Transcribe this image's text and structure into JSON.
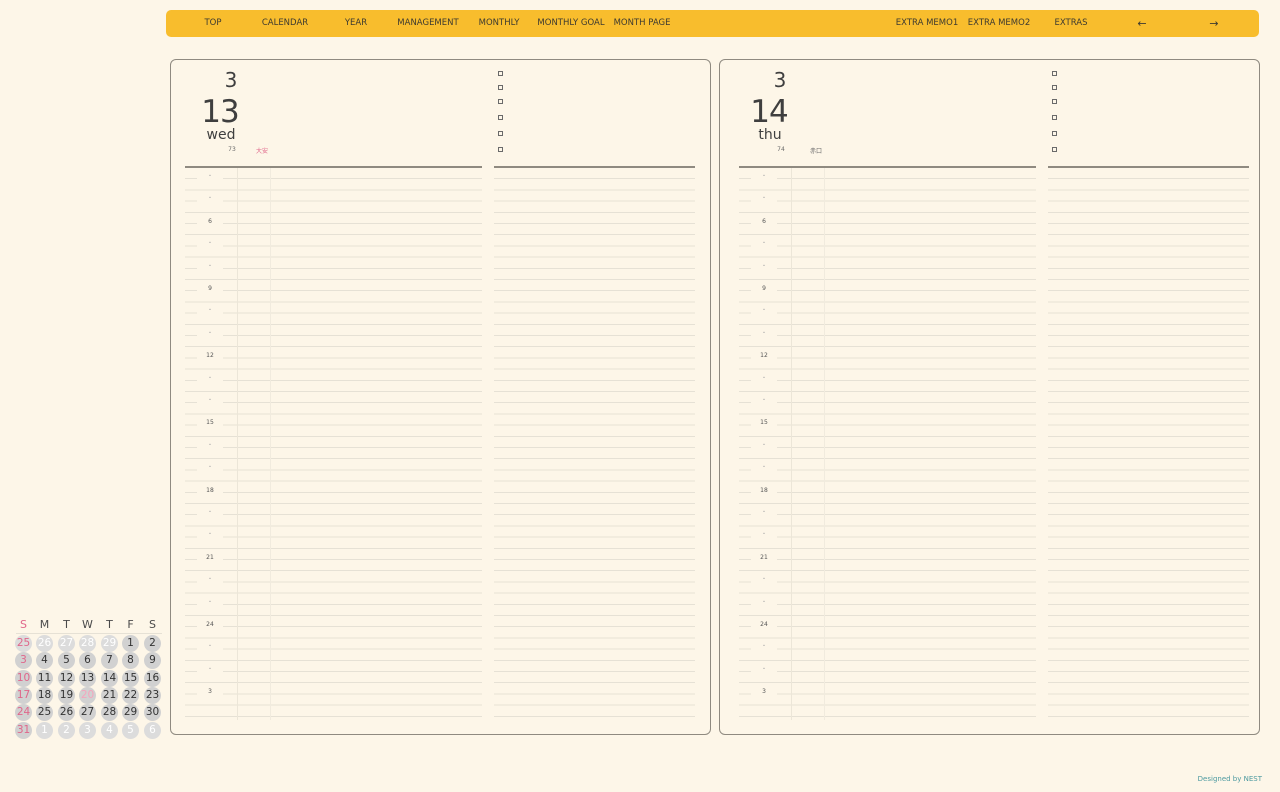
{
  "nav": {
    "items": [
      "TOP",
      "CALENDAR",
      "YEAR",
      "MANAGEMENT",
      "MONTHLY",
      "MONTHLY GOAL",
      "MONTH PAGE",
      "EXTRA MEMO1",
      "EXTRA MEMO2",
      "EXTRAS"
    ],
    "prev_arrow": "←",
    "next_arrow": "→"
  },
  "pages": [
    {
      "month": "3",
      "day": "13",
      "weekday": "wed",
      "day_of_year": "73",
      "note": "大安"
    },
    {
      "month": "3",
      "day": "14",
      "weekday": "thu",
      "day_of_year": "74",
      "note": "赤口"
    }
  ],
  "schedule_hours": [
    "・",
    "・",
    "6",
    "・",
    "・",
    "9",
    "・",
    "・",
    "12",
    "・",
    "・",
    "15",
    "・",
    "・",
    "18",
    "・",
    "・",
    "21",
    "・",
    "・",
    "24",
    "・",
    "・",
    "3"
  ],
  "mini_calendar": {
    "headers": [
      "S",
      "M",
      "T",
      "W",
      "T",
      "F",
      "S"
    ],
    "weeks": [
      [
        "25",
        "26",
        "27",
        "28",
        "29",
        "1",
        "2"
      ],
      [
        "3",
        "4",
        "5",
        "6",
        "7",
        "8",
        "9"
      ],
      [
        "10",
        "11",
        "12",
        "13",
        "14",
        "15",
        "16"
      ],
      [
        "17",
        "18",
        "19",
        "20",
        "21",
        "22",
        "23"
      ],
      [
        "24",
        "25",
        "26",
        "27",
        "28",
        "29",
        "30"
      ],
      [
        "31",
        "1",
        "2",
        "3",
        "4",
        "5",
        "6"
      ]
    ],
    "holiday_day": "20"
  },
  "credit": "Designed by NEST",
  "colors": {
    "accent": "#f8bd2d",
    "background": "#fdf6e8",
    "sunday": "#e0668a",
    "credit": "#4d9aa0"
  }
}
